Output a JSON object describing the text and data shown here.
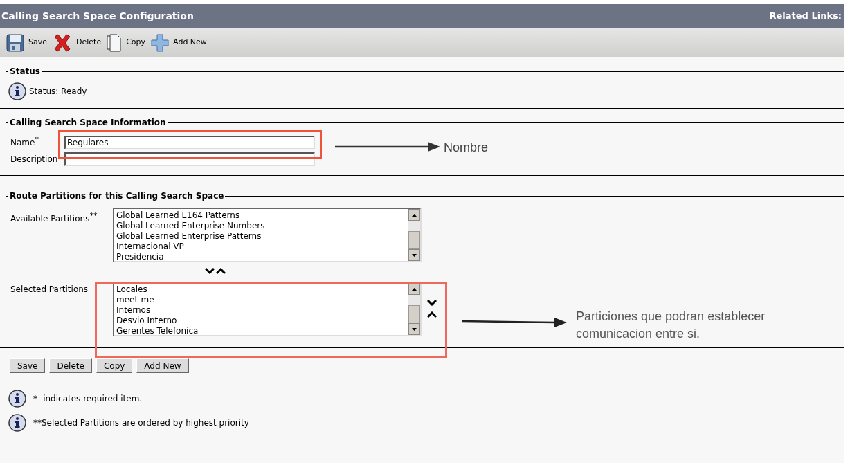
{
  "window": {
    "title": "Calling Search Space Configuration",
    "related_links": "Related Links:"
  },
  "toolbar": [
    {
      "kind": "save",
      "label": "Save"
    },
    {
      "kind": "delete",
      "label": "Delete"
    },
    {
      "kind": "copy",
      "label": "Copy"
    },
    {
      "kind": "add",
      "label": "Add New"
    }
  ],
  "status": {
    "legend": "Status",
    "text": "Status: Ready"
  },
  "info": {
    "legend": "Calling Search Space Information",
    "fields": [
      {
        "label": "Name",
        "required": "*",
        "value": "Regulares"
      },
      {
        "label": "Description"
      }
    ]
  },
  "partitions": {
    "legend": "Route Partitions for this Calling Search Space",
    "available": {
      "label": "Available Partitions",
      "mark": "**",
      "items": [
        "Global Learned E164 Patterns",
        "Global Learned Enterprise Numbers",
        "Global Learned Enterprise Patterns",
        "Internacional VP",
        "Presidencia"
      ]
    },
    "selected": {
      "label": "Selected Partitions",
      "items": [
        "Locales",
        "meet-me",
        "Internos",
        "Desvio Interno",
        "Gerentes Telefonica"
      ]
    }
  },
  "buttons": [
    "Save",
    "Delete",
    "Copy",
    "Add New"
  ],
  "notes": [
    "*- indicates required item.",
    "**Selected Partitions are ordered by highest priority"
  ],
  "annotations": [
    {
      "text": "Nombre"
    },
    {
      "text": "Particiones que podran establecer comunicacion entre si."
    }
  ]
}
